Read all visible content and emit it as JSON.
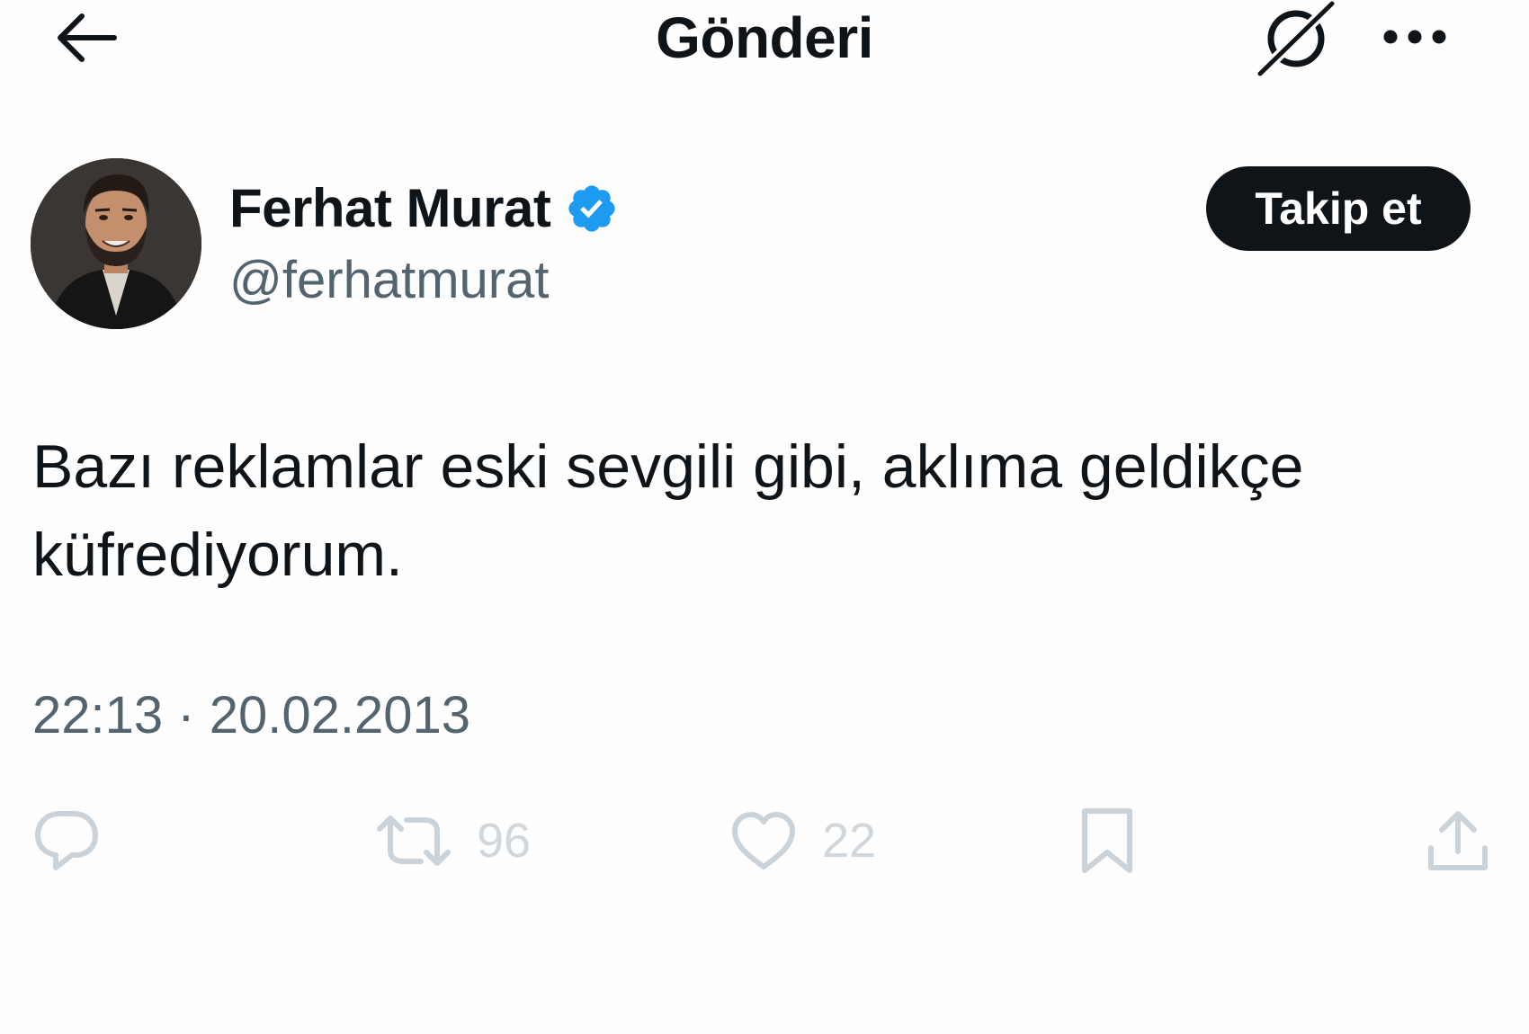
{
  "header": {
    "title": "Gönderi",
    "back_icon": "arrow-left-icon",
    "grok_icon": "grok-icon",
    "more_icon": "more-horizontal-icon"
  },
  "author": {
    "display_name": "Ferhat Murat",
    "handle": "@ferhatmurat",
    "verified_color": "#1d9bf0"
  },
  "follow_button": {
    "label": "Takip et"
  },
  "tweet": {
    "text": "Bazı reklamlar eski sevgili gibi, aklıma geldikçe küfrediyorum.",
    "time": "22:13",
    "separator": " · ",
    "date": "20.02.2013"
  },
  "actions": {
    "reply": {
      "icon": "reply-icon"
    },
    "retweet": {
      "icon": "retweet-icon",
      "count": "96"
    },
    "like": {
      "icon": "heart-icon",
      "count": "22"
    },
    "bookmark": {
      "icon": "bookmark-icon"
    },
    "share": {
      "icon": "share-icon"
    }
  },
  "colors": {
    "text": "#0f1419",
    "secondary": "#536471",
    "action_icons": "#cbd3da",
    "verified": "#1d9bf0"
  }
}
